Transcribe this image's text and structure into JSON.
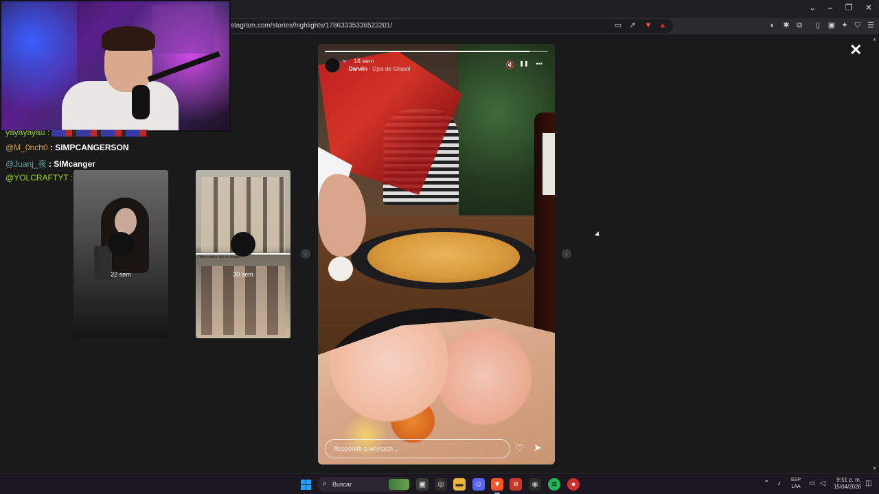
{
  "browser": {
    "url": "stagram.com/stories/highlights/17863335336523201/",
    "window_controls": {
      "collapse": "⌄",
      "minimize": "–",
      "restore": "❐",
      "close": "✕"
    }
  },
  "chat": [
    {
      "user": "yayayayau :",
      "message": "",
      "user_color": "#9bd31f"
    },
    {
      "user": "@M_0nch0",
      "message": ": SIMPCANGERSON",
      "user_color": "#d6a24a"
    },
    {
      "user": "@Juanj_夜",
      "message": ": SIMcanger",
      "user_color": "#5ea3a3"
    },
    {
      "user": "@YOLCRAFTYT :",
      "message": "",
      "user_color": "#9bd31f"
    }
  ],
  "previews": [
    {
      "time": "22 sem"
    },
    {
      "time": "30 sem",
      "caption": "último primer día de clases"
    }
  ],
  "story": {
    "time": "18 sem",
    "username": "Darviin",
    "song": " · Ojos de Girasol",
    "reply_placeholder": "Responde a wnyqxch...",
    "progress": 0.92
  },
  "icons": {
    "mute": "🔇",
    "pause": "❚❚",
    "more": "•••",
    "close": "✕",
    "like": "♡",
    "share": "➤",
    "prev": "‹",
    "next": "›"
  },
  "taskbar": {
    "search_label": "Buscar",
    "language": "ESP",
    "layout": "LAA",
    "time": "9:51 p. m.",
    "date": "15/04/2026"
  },
  "colors": {
    "accent": "#2aa0ff",
    "instagram_bg": "#1a1a1a"
  }
}
